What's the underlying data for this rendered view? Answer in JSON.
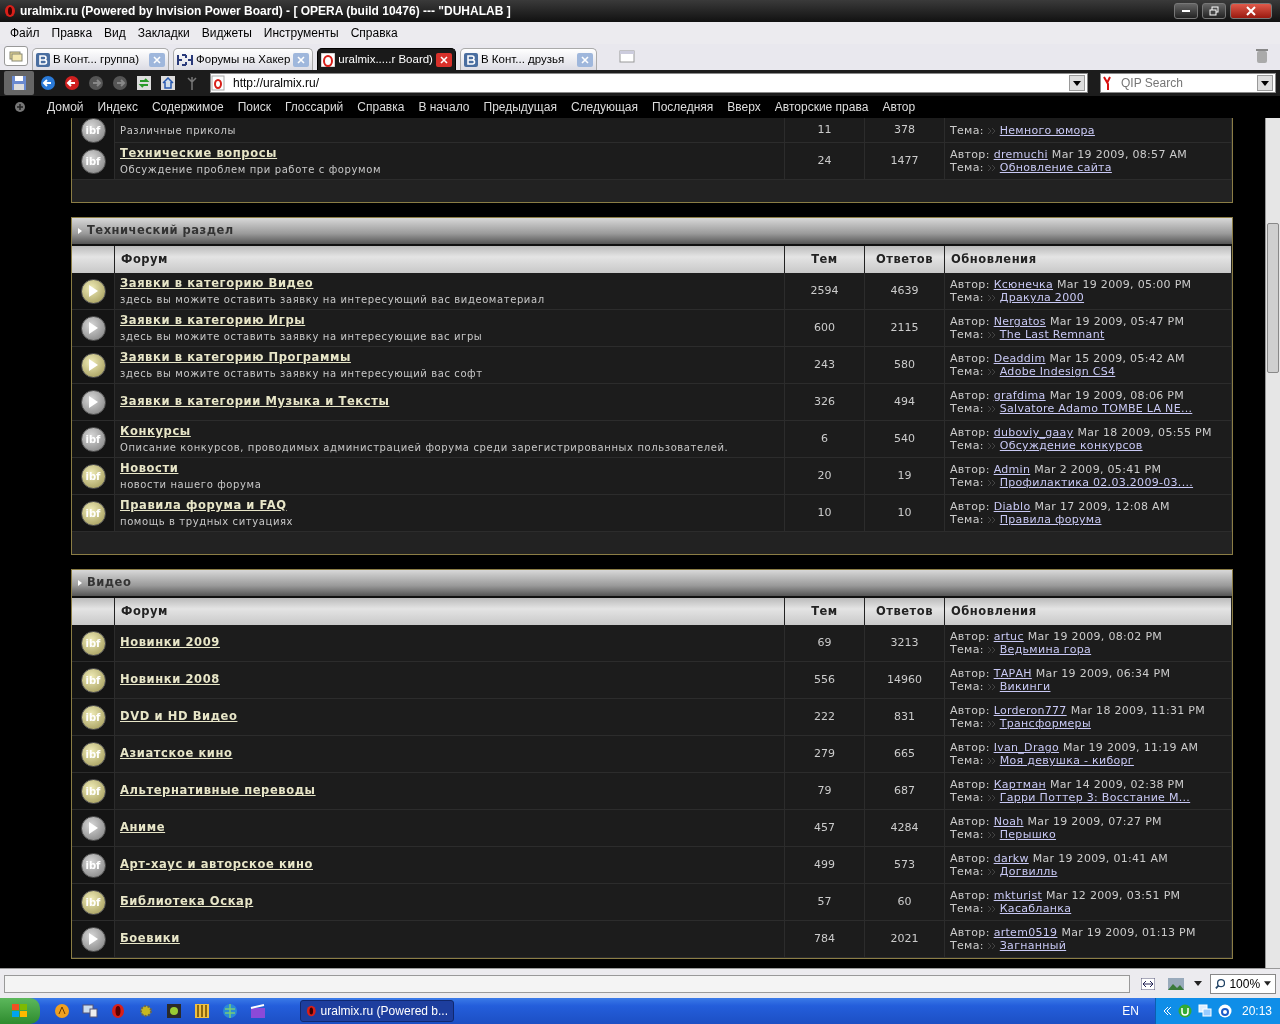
{
  "window": {
    "title": "uralmix.ru (Powered by Invision Power Board) - [ OPERA (build 10476) --- \"DUHALAB ]"
  },
  "menu": [
    "Файл",
    "Правка",
    "Вид",
    "Закладки",
    "Виджеты",
    "Инструменты",
    "Справка"
  ],
  "tabs": [
    {
      "label": "В Конт... группа)",
      "kind": "vk",
      "selected": false
    },
    {
      "label": "Форумы на Хакер",
      "kind": "hacker",
      "selected": false
    },
    {
      "label": "uralmix.....r Board)",
      "kind": "opera",
      "selected": true
    },
    {
      "label": "В Конт... друзья",
      "kind": "vk",
      "selected": false
    }
  ],
  "address": {
    "url": "http://uralmix.ru/"
  },
  "search": {
    "placeholder": "QIP Search"
  },
  "nav_links": [
    "Домой",
    "Индекс",
    "Содержимое",
    "Поиск",
    "Глоссарий",
    "Справка",
    "В начало",
    "Предыдущая",
    "Следующая",
    "Последняя",
    "Вверх",
    "Авторские права",
    "Автор"
  ],
  "sections": [
    {
      "forums": [
        {
          "description": "Различные приколы",
          "icon": {
            "kind": "ibf",
            "label": "ibf",
            "new": false
          },
          "topics": "11",
          "replies": "378",
          "last": {
            "topic_label": "Тема:",
            "topic": "Немного юмора"
          }
        },
        {
          "name": "Технические вопросы",
          "description": "Обсуждение проблем при работе с форумом",
          "icon": {
            "kind": "ibf",
            "label": "ibf",
            "new": false
          },
          "topics": "24",
          "replies": "1477",
          "last": {
            "author_label": "Автор:",
            "author": "dremuchi",
            "date": "Mar 19 2009, 08:57 AM",
            "topic_label": "Тема:",
            "topic": "Обновление сайта"
          }
        }
      ]
    },
    {
      "title": "Технический раздел",
      "columns": [
        "Форум",
        "Тем",
        "Ответов",
        "Обновления"
      ],
      "forums": [
        {
          "name": "Заявки в категорию Видео",
          "description": "здесь вы можите оставить заявку на интересующий вас видеоматериал",
          "icon": {
            "kind": "play",
            "new": true
          },
          "topics": "2594",
          "replies": "4639",
          "last": {
            "author_label": "Автор:",
            "author": "Ксюнечка",
            "date": "Mar 19 2009, 05:00 PM",
            "topic_label": "Тема:",
            "topic": "Дракула 2000"
          }
        },
        {
          "name": "Заявки в категорию Игры",
          "description": "здесь вы можите оставить заявку на интересующие вас игры",
          "icon": {
            "kind": "play",
            "new": false
          },
          "topics": "600",
          "replies": "2115",
          "last": {
            "author_label": "Автор:",
            "author": "Nergatos",
            "date": "Mar 19 2009, 05:47 PM",
            "topic_label": "Тема:",
            "topic": "The Last Remnant"
          }
        },
        {
          "name": "Заявки в категорию Программы",
          "description": "здесь вы можите оставить заявку на интересующий вас софт",
          "icon": {
            "kind": "play",
            "new": true
          },
          "topics": "243",
          "replies": "580",
          "last": {
            "author_label": "Автор:",
            "author": "Deaddim",
            "date": "Mar 15 2009, 05:42 AM",
            "topic_label": "Тема:",
            "topic": "Adobe Indesign CS4"
          }
        },
        {
          "name": "Заявки в категории Музыка и Тексты",
          "icon": {
            "kind": "play",
            "new": false
          },
          "topics": "326",
          "replies": "494",
          "last": {
            "author_label": "Автор:",
            "author": "grafdima",
            "date": "Mar 19 2009, 08:06 PM",
            "topic_label": "Тема:",
            "topic": "Salvatore Adamo TOMBE LA NE..."
          }
        },
        {
          "name": "Конкурсы",
          "description": "Описание конкурсов, проводимых администрацией форума среди зарегистрированных пользователей.",
          "icon": {
            "kind": "ibf",
            "label": "ibf",
            "new": false
          },
          "topics": "6",
          "replies": "540",
          "last": {
            "author_label": "Автор:",
            "author": "duboviy_gaay",
            "date": "Mar 18 2009, 05:55 PM",
            "topic_label": "Тема:",
            "topic": "Обсуждение конкурсов"
          }
        },
        {
          "name": "Новости",
          "description": "новости нашего форума",
          "icon": {
            "kind": "ibf",
            "label": "ibf",
            "new": true
          },
          "topics": "20",
          "replies": "19",
          "last": {
            "author_label": "Автор:",
            "author": "Admin",
            "date": "Mar 2 2009, 05:41 PM",
            "topic_label": "Тема:",
            "topic": "Профилактика 02.03.2009-03...."
          }
        },
        {
          "name": "Правила форума и FAQ",
          "description": "помощь в трудных ситуациях",
          "icon": {
            "kind": "ibf",
            "label": "ibf",
            "new": true
          },
          "topics": "10",
          "replies": "10",
          "last": {
            "author_label": "Автор:",
            "author": "Diablo",
            "date": "Mar 17 2009, 12:08 AM",
            "topic_label": "Тема:",
            "topic": "Правила форума"
          }
        }
      ]
    },
    {
      "title": "Видео",
      "columns": [
        "Форум",
        "Тем",
        "Ответов",
        "Обновления"
      ],
      "forums": [
        {
          "name": "Новинки 2009",
          "icon": {
            "kind": "ibf",
            "label": "ibf",
            "new": true
          },
          "topics": "69",
          "replies": "3213",
          "last": {
            "author_label": "Автор:",
            "author": "artuc",
            "date": "Mar 19 2009, 08:02 PM",
            "topic_label": "Тема:",
            "topic": "Ведьмина гора"
          }
        },
        {
          "name": "Новинки 2008",
          "icon": {
            "kind": "ibf",
            "label": "ibf",
            "new": true
          },
          "topics": "556",
          "replies": "14960",
          "last": {
            "author_label": "Автор:",
            "author": "ТАРАН",
            "date": "Mar 19 2009, 06:34 PM",
            "topic_label": "Тема:",
            "topic": "Викинги"
          }
        },
        {
          "name": "DVD и HD Видео",
          "icon": {
            "kind": "ibf",
            "label": "ibf",
            "new": true
          },
          "topics": "222",
          "replies": "831",
          "last": {
            "author_label": "Автор:",
            "author": "Lorderon777",
            "date": "Mar 18 2009, 11:31 PM",
            "topic_label": "Тема:",
            "topic": "Трансформеры"
          }
        },
        {
          "name": "Азиатское кино",
          "icon": {
            "kind": "ibf",
            "label": "ibf",
            "new": true
          },
          "topics": "279",
          "replies": "665",
          "last": {
            "author_label": "Автор:",
            "author": "Ivan_Drago",
            "date": "Mar 19 2009, 11:19 AM",
            "topic_label": "Тема:",
            "topic": "Моя девушка - киборг"
          }
        },
        {
          "name": "Альтернативные переводы",
          "icon": {
            "kind": "ibf",
            "label": "ibf",
            "new": true
          },
          "topics": "79",
          "replies": "687",
          "last": {
            "author_label": "Автор:",
            "author": "Картман",
            "date": "Mar 14 2009, 02:38 PM",
            "topic_label": "Тема:",
            "topic": "Гарри Поттер 3: Восстание М..."
          }
        },
        {
          "name": "Аниме",
          "icon": {
            "kind": "play",
            "new": false
          },
          "topics": "457",
          "replies": "4284",
          "last": {
            "author_label": "Автор:",
            "author": "Noah",
            "date": "Mar 19 2009, 07:27 PM",
            "topic_label": "Тема:",
            "topic": "Перышко"
          }
        },
        {
          "name": "Арт-хаус и авторское кино",
          "icon": {
            "kind": "ibf",
            "label": "ibf",
            "new": false
          },
          "topics": "499",
          "replies": "573",
          "last": {
            "author_label": "Автор:",
            "author": "darkw",
            "date": "Mar 19 2009, 01:41 AM",
            "topic_label": "Тема:",
            "topic": "Догвилль"
          }
        },
        {
          "name": "Библиотека Оскар",
          "icon": {
            "kind": "ibf",
            "label": "ibf",
            "new": true
          },
          "topics": "57",
          "replies": "60",
          "last": {
            "author_label": "Автор:",
            "author": "mkturist",
            "date": "Mar 12 2009, 03:51 PM",
            "topic_label": "Тема:",
            "topic": "Касабланка"
          }
        },
        {
          "name": "Боевики",
          "icon": {
            "kind": "play",
            "new": false
          },
          "topics": "784",
          "replies": "2021",
          "last": {
            "author_label": "Автор:",
            "author": "artem0519",
            "date": "Mar 19 2009, 01:13 PM",
            "topic_label": "Тема:",
            "topic": "Загнанный"
          }
        }
      ]
    }
  ],
  "status_bar": {
    "zoom": "100%"
  },
  "taskbar": {
    "task": "uralmix.ru (Powered b...",
    "language": "EN",
    "clock": "20:13"
  }
}
